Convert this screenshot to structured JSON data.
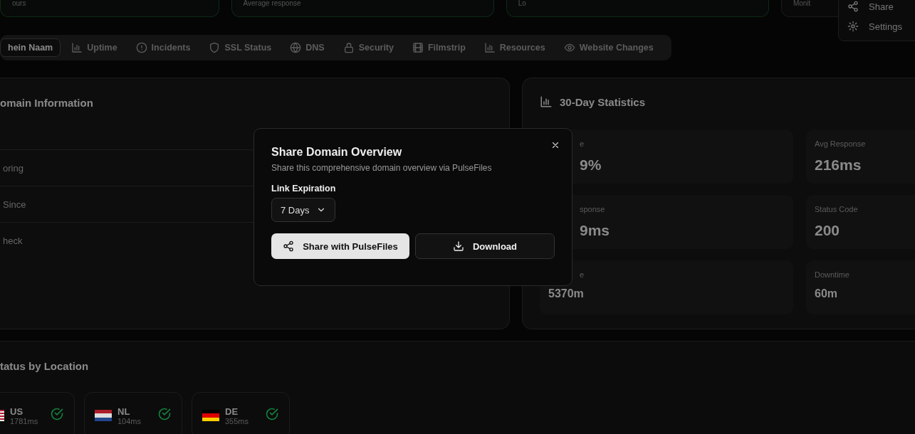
{
  "top_cards": [
    {
      "label": "ours"
    },
    {
      "label": "Average response"
    },
    {
      "label": "Lo"
    },
    {
      "label": "Monit"
    }
  ],
  "header_menu": {
    "items": [
      {
        "label": "Share"
      },
      {
        "label": "Settings"
      }
    ]
  },
  "tabs": [
    {
      "label": "hein Naam",
      "selected": true
    },
    {
      "label": "Uptime",
      "selected": false
    },
    {
      "label": "Incidents",
      "selected": false
    },
    {
      "label": "SSL Status",
      "selected": false
    },
    {
      "label": "DNS",
      "selected": false
    },
    {
      "label": "Security",
      "selected": false
    },
    {
      "label": "Filmstrip",
      "selected": false
    },
    {
      "label": "Resources",
      "selected": false
    },
    {
      "label": "Website Changes",
      "selected": false
    }
  ],
  "domain_info": {
    "title": "omain Information",
    "rows": [
      {
        "label": "oring"
      },
      {
        "label": "Since"
      },
      {
        "label": "heck"
      }
    ]
  },
  "statistics": {
    "title": "30-Day Statistics",
    "items": [
      {
        "label": "e",
        "value": "9%"
      },
      {
        "label": "Avg Response",
        "value": "216ms"
      },
      {
        "label": "sponse",
        "value": "9ms"
      },
      {
        "label": "Status Code",
        "value": "200"
      },
      {
        "label": "e",
        "value": "5370m"
      },
      {
        "label": "Downtime",
        "value": "60m"
      }
    ]
  },
  "locations": {
    "title": "tatus by Location",
    "items": [
      {
        "code": "US",
        "latency": "1781ms"
      },
      {
        "code": "NL",
        "latency": "104ms"
      },
      {
        "code": "DE",
        "latency": "355ms"
      }
    ]
  },
  "share_dialog": {
    "title": "Share Domain Overview",
    "description": "Share this comprehensive domain overview via PulseFiles",
    "field_label": "Link Expiration",
    "expiration": "7 Days",
    "buttons": [
      {
        "label": "Share with PulseFiles",
        "kind": "primary"
      },
      {
        "label": "Download",
        "kind": "secondary"
      }
    ]
  }
}
